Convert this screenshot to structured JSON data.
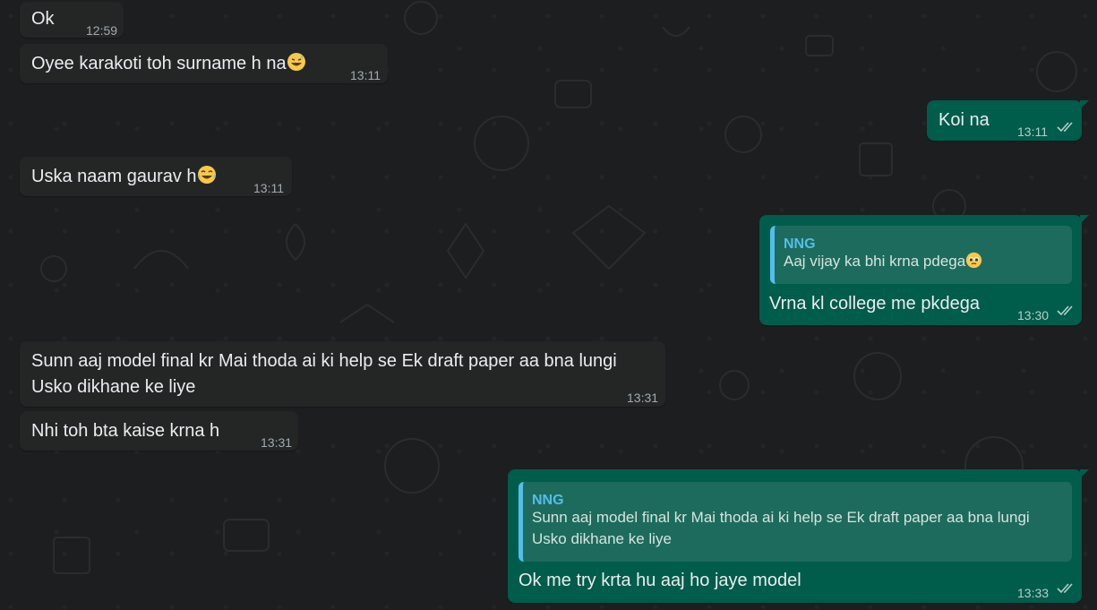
{
  "messages": [
    {
      "id": "m1",
      "direction": "in",
      "text": "Ok",
      "time": "12:59"
    },
    {
      "id": "m2",
      "direction": "in",
      "text": "Oyee karakoti toh surname h na",
      "emoji": "grinning-sweat-emoji",
      "time": "13:11"
    },
    {
      "id": "m3",
      "direction": "out",
      "text": "Koi na",
      "time": "13:11",
      "status": "double-tick-icon"
    },
    {
      "id": "m4",
      "direction": "in",
      "text": "Uska naam gaurav h",
      "emoji": "tears-of-joy-emoji",
      "time": "13:11"
    },
    {
      "id": "m5",
      "direction": "out",
      "quote": {
        "author": "NNG",
        "text": "Aaj vijay ka bhi krna pdega",
        "emoji": "pleading-face-emoji"
      },
      "text": "Vrna kl college me pkdega",
      "time": "13:30",
      "status": "double-tick-icon"
    },
    {
      "id": "m6",
      "direction": "in",
      "lines": [
        "Sunn aaj model final kr Mai thoda ai ki help se Ek draft paper aa bna lungi",
        "Usko dikhane ke liye"
      ],
      "time": "13:31"
    },
    {
      "id": "m7",
      "direction": "in",
      "text": "Nhi toh bta kaise krna h",
      "time": "13:31"
    },
    {
      "id": "m8",
      "direction": "out",
      "quote": {
        "author": "NNG",
        "lines": [
          "Sunn aaj model final kr Mai thoda ai ki help se Ek draft paper aa bna lungi",
          "Usko dikhane ke liye"
        ]
      },
      "text": "Ok me try krta hu aaj ho jaye model",
      "time": "13:33",
      "status": "double-tick-icon"
    }
  ],
  "colors": {
    "incoming_bubble": "#242626",
    "outgoing_bubble": "#005c4b",
    "quote_bar": "#53bdeb",
    "background": "#1c1e1f"
  }
}
